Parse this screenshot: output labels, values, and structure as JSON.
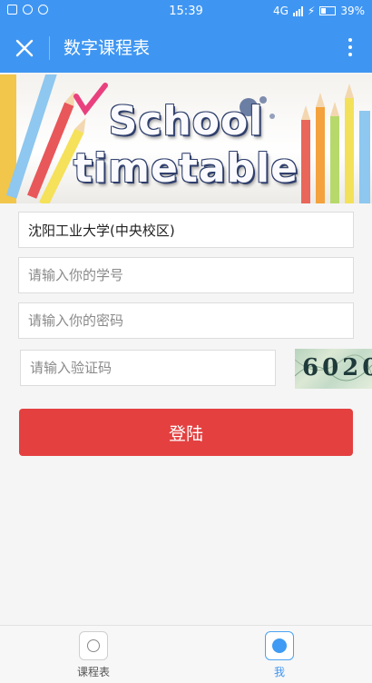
{
  "status_bar": {
    "time": "15:39",
    "network": "4G",
    "battery": "39%"
  },
  "app_bar": {
    "title": "数字课程表",
    "close_icon": "close-icon",
    "more_icon": "more-vertical-icon"
  },
  "banner": {
    "line1": "School",
    "line2": "timetable"
  },
  "form": {
    "school_value": "沈阳工业大学(中央校区)",
    "student_id_placeholder": "请输入你的学号",
    "password_placeholder": "请输入你的密码",
    "captcha_placeholder": "请输入验证码",
    "captcha_image_text": "6020",
    "login_label": "登陆"
  },
  "tabs": [
    {
      "label": "课程表",
      "active": false
    },
    {
      "label": "我",
      "active": true
    }
  ],
  "colors": {
    "primary": "#3f96f2",
    "login_button": "#e44040"
  }
}
